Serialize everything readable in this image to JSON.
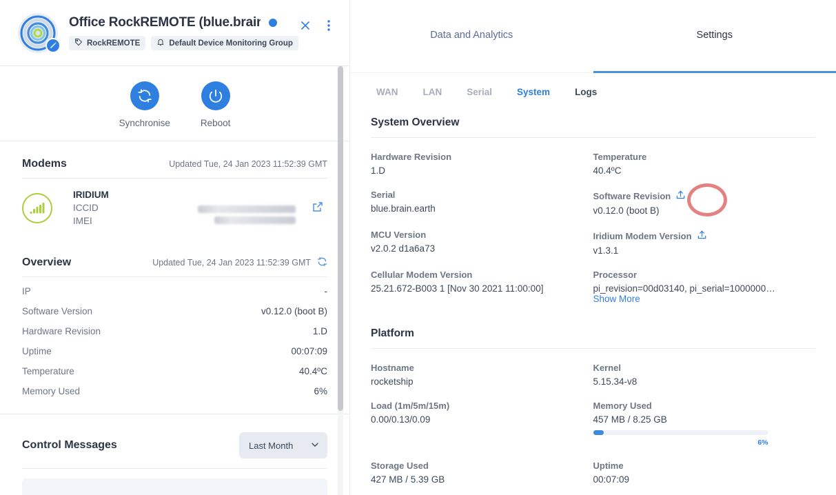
{
  "device": {
    "title": "Office RockREMOTE (blue.brain....",
    "status": "online",
    "avatar_icon": "concentric-circles-logo",
    "edit_badge_icon": "pencil-icon",
    "status_dot_color": "#2f7fe0",
    "tags": [
      {
        "icon": "tag-icon",
        "label": "RockREMOTE"
      },
      {
        "icon": "bell-icon",
        "label": "Default Device Monitoring Group"
      }
    ],
    "header_actions": [
      {
        "icon": "close-icon",
        "name": "close-button"
      },
      {
        "icon": "kebab-menu-icon",
        "name": "more-options-button"
      }
    ]
  },
  "quick_actions": [
    {
      "icon": "sync-icon",
      "label": "Synchronise"
    },
    {
      "icon": "power-icon",
      "label": "Reboot"
    }
  ],
  "modems": {
    "title": "Modems",
    "updated": "Updated Tue, 24 Jan 2023 11:52:39 GMT",
    "entries": [
      {
        "icon": "signal-bars-icon",
        "name": "IRIDIUM",
        "fields": [
          {
            "key": "ICCID",
            "value": "",
            "redacted": true
          },
          {
            "key": "IMEI",
            "value": "",
            "redacted": true
          }
        ],
        "link_icon": "external-link-icon"
      }
    ]
  },
  "overview": {
    "title": "Overview",
    "updated": "Updated Tue, 24 Jan 2023 11:52:39 GMT",
    "refresh_icon": "refresh-icon",
    "rows": [
      {
        "key": "IP",
        "value": "-"
      },
      {
        "key": "Software Version",
        "value": "v0.12.0 (boot B)"
      },
      {
        "key": "Hardware Revision",
        "value": "1.D"
      },
      {
        "key": "Uptime",
        "value": "00:07:09"
      },
      {
        "key": "Temperature",
        "value": "40.4ºC"
      },
      {
        "key": "Memory Used",
        "value": "6%"
      }
    ]
  },
  "control_messages": {
    "title": "Control Messages",
    "range_selected": "Last Month",
    "range_icon": "chevron-down-icon"
  },
  "right": {
    "top_tabs": [
      {
        "label": "Data and Analytics",
        "active": false
      },
      {
        "label": "Settings",
        "active": true
      }
    ],
    "sub_tabs": [
      {
        "label": "WAN",
        "state": "inactive"
      },
      {
        "label": "LAN",
        "state": "inactive"
      },
      {
        "label": "Serial",
        "state": "inactive"
      },
      {
        "label": "System",
        "state": "active"
      },
      {
        "label": "Logs",
        "state": "plain"
      }
    ],
    "system_overview": {
      "title": "System Overview",
      "fields": [
        {
          "label": "Hardware Revision",
          "value": "1.D",
          "icon": null,
          "col": "left"
        },
        {
          "label": "Temperature",
          "value": "40.4ºC",
          "icon": null,
          "col": "right"
        },
        {
          "label": "Serial",
          "value": "blue.brain.earth",
          "icon": null,
          "col": "left"
        },
        {
          "label": "Software Revision",
          "value": "v0.12.0 (boot B)",
          "icon": "upload-icon",
          "col": "right"
        },
        {
          "label": "MCU Version",
          "value": "v2.0.2 d1a6a73",
          "icon": null,
          "col": "left"
        },
        {
          "label": "Iridium Modem Version",
          "value": "v1.3.1",
          "icon": "upload-icon",
          "col": "right"
        },
        {
          "label": "Cellular Modem Version",
          "value": "25.21.672-B003 1 [Nov 30 2021 11:00:00]",
          "icon": null,
          "col": "left"
        },
        {
          "label": "Processor",
          "value": "pi_revision=00d03140, pi_serial=1000000…",
          "icon": null,
          "col": "right",
          "more_link": "Show More"
        }
      ]
    },
    "platform": {
      "title": "Platform",
      "fields": [
        {
          "label": "Hostname",
          "value": "rocketship",
          "col": "left"
        },
        {
          "label": "Kernel",
          "value": "5.15.34-v8",
          "col": "right"
        },
        {
          "label": "Load (1m/5m/15m)",
          "value": "0.00/0.13/0.09",
          "col": "left"
        },
        {
          "label": "Memory Used",
          "value": "457 MB / 8.25 GB",
          "col": "right",
          "progress": 6,
          "progress_label": "6%"
        },
        {
          "label": "Storage Used",
          "value": "427 MB / 5.39 GB",
          "col": "left"
        },
        {
          "label": "Uptime",
          "value": "00:07:09",
          "col": "right"
        }
      ]
    }
  },
  "annotation": {
    "type": "circle-highlight",
    "color": "#df6b6b",
    "target": "software-revision-upload-icon"
  },
  "colors": {
    "accent": "#2f7fe0",
    "tab_underline": "#4a90e2",
    "signal_green": "#a9cf3a",
    "annotation_red": "#df6b6b",
    "text_dark": "#2b3445",
    "text_muted": "#6d7685"
  }
}
